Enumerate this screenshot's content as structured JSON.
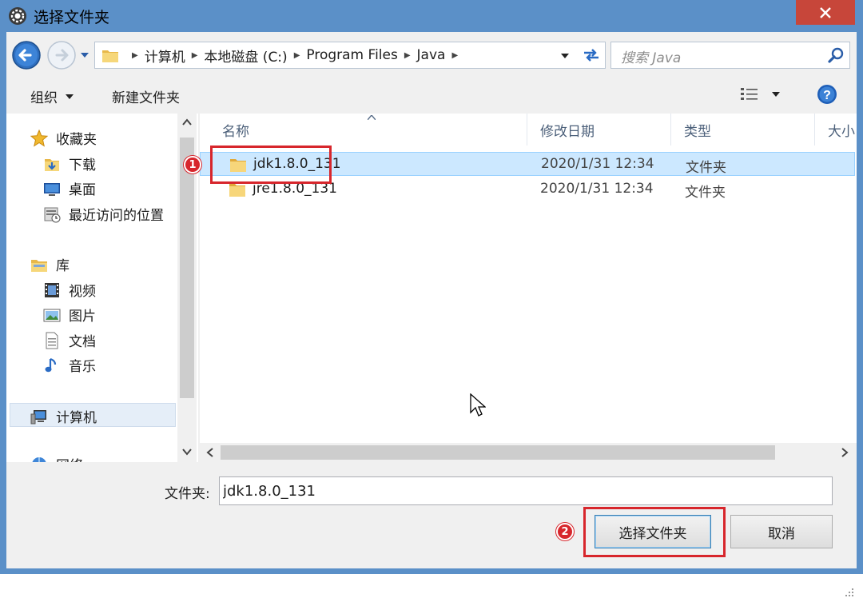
{
  "window": {
    "title": "选择文件夹",
    "icon": "gear-icon"
  },
  "address": {
    "crumbs": [
      "计算机",
      "本地磁盘 (C:)",
      "Program Files",
      "Java"
    ],
    "search_placeholder": "搜索 Java"
  },
  "toolbar": {
    "organize_label": "组织",
    "new_folder_label": "新建文件夹"
  },
  "sidebar": {
    "favorites_label": "收藏夹",
    "favorites": [
      "下载",
      "桌面",
      "最近访问的位置"
    ],
    "libraries_label": "库",
    "libraries": [
      "视频",
      "图片",
      "文档",
      "音乐"
    ],
    "computer_label": "计算机",
    "network_label": "网络"
  },
  "columns": [
    "名称",
    "修改日期",
    "类型",
    "大小"
  ],
  "files": [
    {
      "name": "jdk1.8.0_131",
      "date": "2020/1/31 12:34",
      "type": "文件夹",
      "selected": true
    },
    {
      "name": "jre1.8.0_131",
      "date": "2020/1/31 12:34",
      "type": "文件夹",
      "selected": false
    }
  ],
  "footer": {
    "folder_label": "文件夹:",
    "folder_value": "jdk1.8.0_131",
    "select_button": "选择文件夹",
    "cancel_button": "取消"
  },
  "annotations": {
    "step1": "1",
    "step2": "2",
    "color": "#d7262c"
  },
  "colors": {
    "titlebar": "#5b90c8",
    "close_button": "#c7463a",
    "selection": "#cce8ff"
  }
}
